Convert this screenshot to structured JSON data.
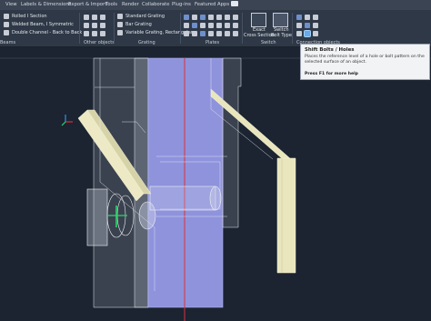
{
  "menu": [
    "View",
    "Labels & Dimensions",
    "Export & Import",
    "Tools",
    "Render",
    "Collaborate",
    "Plug-ins",
    "Featured Apps"
  ],
  "ribbon": {
    "beams_group": {
      "items": [
        "Rolled I Section",
        "Welded Beam, I Symmetric",
        "Double Channel - Back to Back"
      ],
      "label": "Beams"
    },
    "other_objects": {
      "label": "Other objects"
    },
    "grating_group": {
      "items": [
        "Standard Grating",
        "Bar Grating",
        "Variable Grating, Rectangular"
      ],
      "label": "Grating"
    },
    "plates": {
      "label": "Plates"
    },
    "switch_group": {
      "exact_label_1": "Exact",
      "exact_label_2": "Cross Section",
      "bolt_label_1": "Switch",
      "bolt_label_2": "Bolt Type",
      "label": "Switch"
    },
    "connection_objects": {
      "label": "Connection objects"
    }
  },
  "tooltip": {
    "title": "Shift Bolts / Holes",
    "description": "Places the reference level of a hole or bolt pattern on the selected surface of an object.",
    "help": "Press F1 for more help"
  },
  "colors": {
    "background": "#1b2430",
    "ribbon": "#2e3846",
    "column": "#8f93dc",
    "beam": "#e9e6bd",
    "section_line": "#d83040"
  }
}
